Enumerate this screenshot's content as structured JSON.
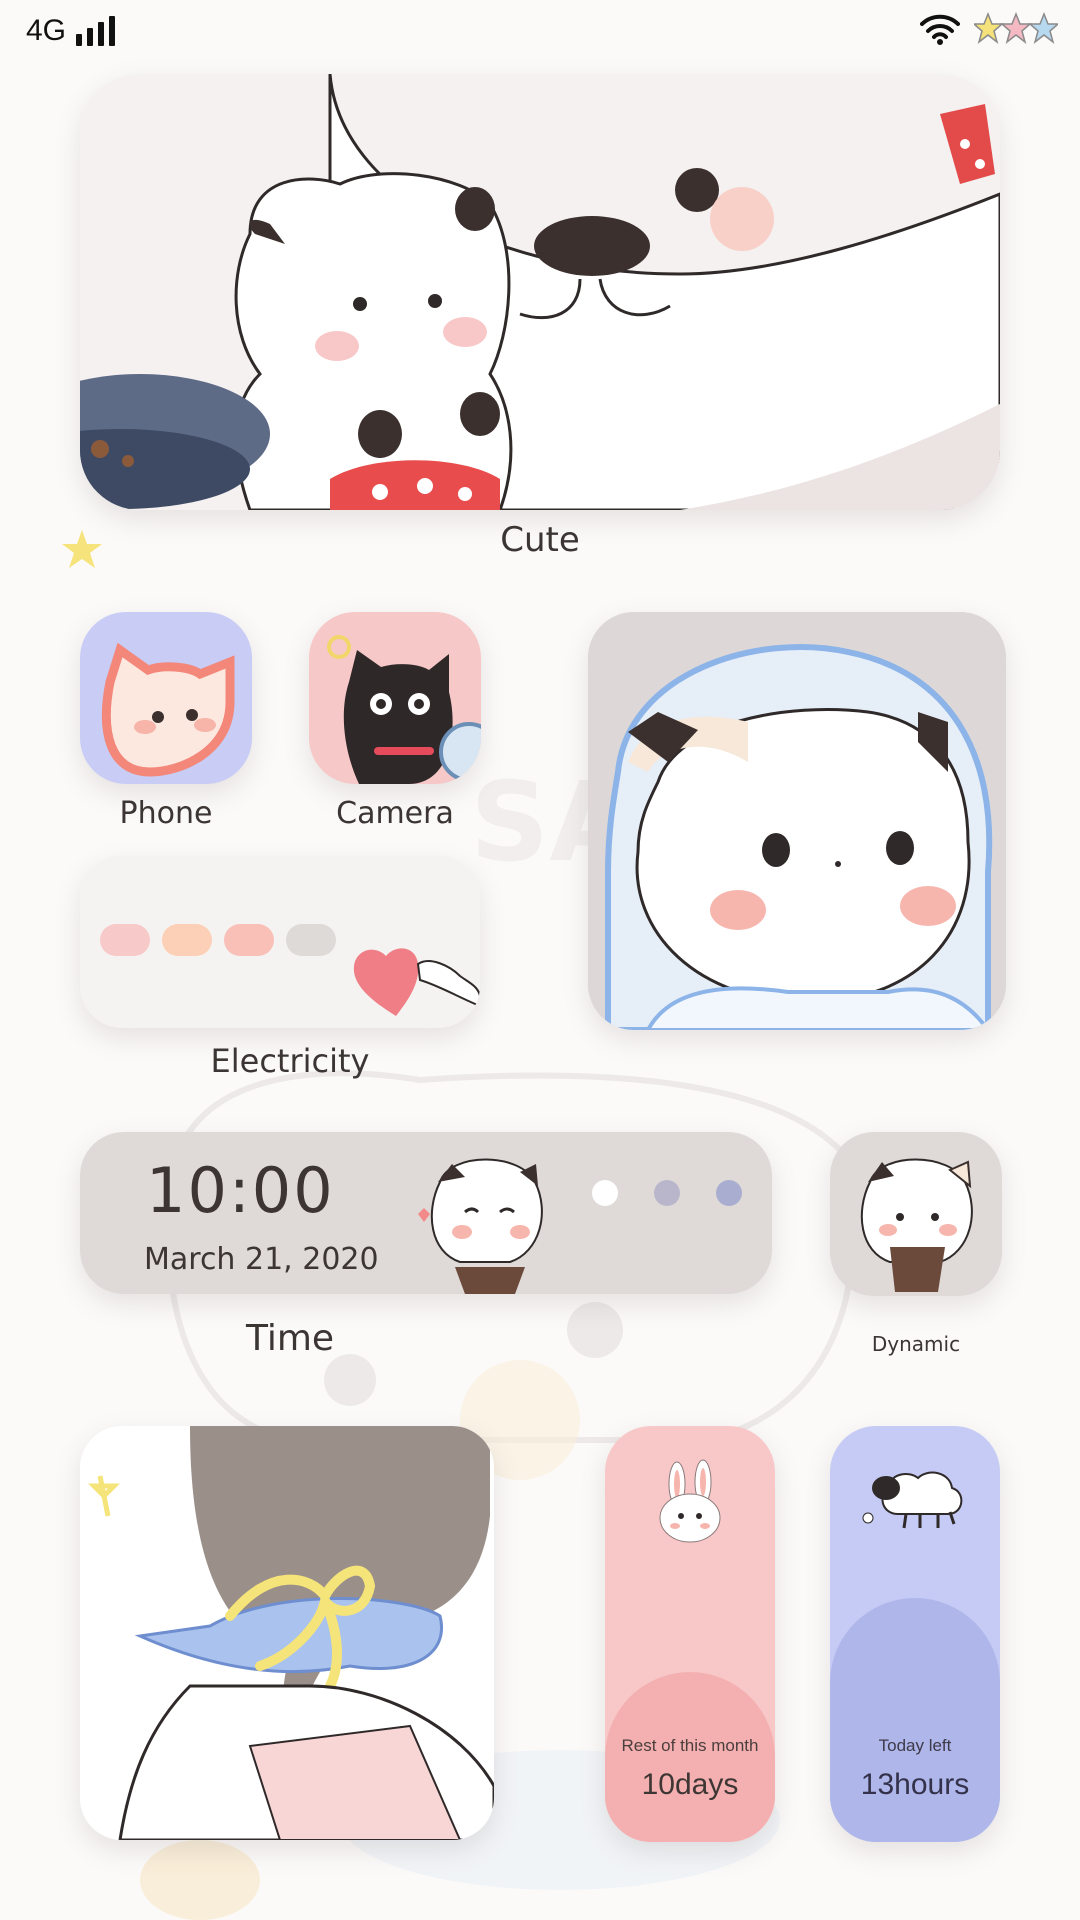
{
  "status_bar": {
    "network": "4G",
    "icons": [
      "signal-bars-icon",
      "wifi-icon",
      "stars-icon"
    ]
  },
  "widgets": {
    "cute": {
      "label": "Cute"
    },
    "phone": {
      "label": "Phone"
    },
    "camera": {
      "label": "Camera"
    },
    "electricity": {
      "label": "Electricity",
      "dot_colors": [
        "#f8c9c9",
        "#fbd0b6",
        "#f9c0b8",
        "#dedad8"
      ]
    },
    "time": {
      "label": "Time",
      "clock": "10:00",
      "date": "March 21, 2020",
      "dot_colors": [
        "#ffffff",
        "#b9b6cc",
        "#a9aed0"
      ]
    },
    "dynamic": {
      "label": "Dynamic"
    },
    "month": {
      "caption": "Rest of this month",
      "value": "10days"
    },
    "today": {
      "caption": "Today left",
      "value": "13hours"
    }
  },
  "colors": {
    "background": "#fbfaf9",
    "card_grey": "#dfdad8",
    "pink": "#f8c8c8",
    "pink_dark": "#f4b0b0",
    "blue": "#c5cbf4",
    "blue_dark": "#aeb6ea"
  }
}
